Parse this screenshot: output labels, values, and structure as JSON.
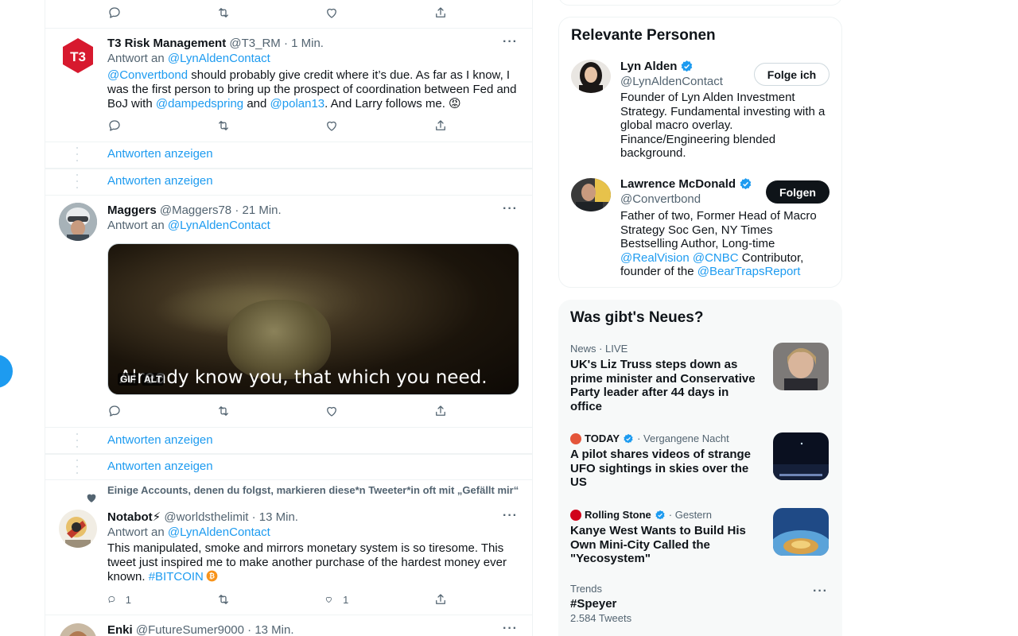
{
  "timeline": {
    "tweet1": {
      "name": "T3 Risk Management",
      "handle": "@T3_RM",
      "time": "· 1 Min.",
      "reply_prefix": "Antwort an",
      "reply_to": "@LynAldenContact",
      "text_mention1": "@Convertbond",
      "text_part1": " should probably give credit where it’s due. As far as I know, I was the first person to bring up the prospect of coordination between Fed and BoJ with ",
      "text_mention2": "@dampedspring",
      "text_and": " and ",
      "text_mention3": "@polan13",
      "text_part2": ". And Larry follows me. 😡"
    },
    "show_replies_1": "Antworten anzeigen",
    "show_replies_2": "Antworten anzeigen",
    "tweet2": {
      "name": "Maggers",
      "handle": "@Maggers78",
      "time": "· 21 Min.",
      "reply_prefix": "Antwort an",
      "reply_to": "@LynAldenContact",
      "gif_caption": "Already know you, that which you need.",
      "gif_badge": "GIF",
      "alt_badge": "ALT"
    },
    "show_replies_3": "Antworten anzeigen",
    "show_replies_4": "Antworten anzeigen",
    "tweet3": {
      "social_context": "Einige Accounts, denen du folgst, markieren diese*n Tweeter*in oft mit „Gefällt mir“",
      "name": "Notabot⚡",
      "handle": "@worldsthelimit",
      "time": "· 13 Min.",
      "reply_prefix": "Antwort an",
      "reply_to": "@LynAldenContact",
      "text_part1": "This manipulated, smoke and mirrors monetary system is so tiresome. This tweet just inspired me to make another purchase of the hardest money ever known. ",
      "hashtag": "#BITCOIN",
      "reply_count": "1",
      "like_count": "1"
    },
    "tweet4": {
      "name": "Enki",
      "handle": "@FutureSumer9000",
      "time": "· 13 Min."
    },
    "more_label": "···"
  },
  "sidebar": {
    "people": {
      "title": "Relevante Personen",
      "person1": {
        "name": "Lyn Alden",
        "handle": "@LynAldenContact",
        "button": "Folge ich",
        "bio": "Founder of Lyn Alden Investment Strategy. Fundamental investing with a global macro overlay. Finance/Engineering blended background."
      },
      "person2": {
        "name": "Lawrence McDonald",
        "handle": "@Convertbond",
        "button": "Folgen",
        "bio_part1": "Father of two, Former Head of Macro Strategy Soc Gen, NY Times Bestselling Author, Long-time ",
        "bio_mention1": "@RealVision",
        "bio_space": " ",
        "bio_mention2": "@CNBC",
        "bio_part2": " Contributor, founder of the ",
        "bio_mention3": "@BearTrapsReport"
      }
    },
    "news": {
      "title": "Was gibt's Neues?",
      "item1": {
        "meta": "News · LIVE",
        "title": "UK's Liz Truss steps down as prime minister and Conservative Party leader after 44 days in office"
      },
      "item2": {
        "source": "TODAY",
        "when": "· Vergangene Nacht",
        "title": "A pilot shares videos of strange UFO sightings in skies over the US"
      },
      "item3": {
        "source": "Rolling Stone",
        "when": "· Gestern",
        "title": "Kanye West Wants to Build His Own Mini-City Called the \"Yecosystem\""
      },
      "trend": {
        "label": "Trends",
        "name": "#Speyer",
        "count": "2.584 Tweets",
        "more": "···"
      }
    }
  },
  "colors": {
    "accent": "#1d9bf0",
    "text": "#0f1419",
    "muted": "#536471",
    "border": "#eff3f4"
  }
}
